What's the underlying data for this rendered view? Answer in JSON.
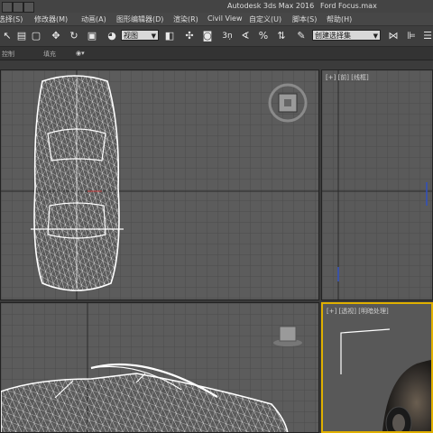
{
  "window": {
    "app_title": "Autodesk 3ds Max 2016",
    "file_title": "Ford Focus.max"
  },
  "menu": {
    "items": [
      {
        "id": "select",
        "label": "选择(S)"
      },
      {
        "id": "modifiers",
        "label": "修改器(M)"
      },
      {
        "id": "animation",
        "label": "动画(A)"
      },
      {
        "id": "graph-editors",
        "label": "图形编辑器(D)"
      },
      {
        "id": "rendering",
        "label": "渲染(R)"
      },
      {
        "id": "civil-view",
        "label": "Civil View"
      },
      {
        "id": "customize",
        "label": "自定义(U)"
      },
      {
        "id": "maxscript",
        "label": "脚本(S)"
      },
      {
        "id": "help",
        "label": "帮助(H)"
      }
    ]
  },
  "toolbar": {
    "reference_coord": "视图",
    "named_selection": "创建选择集",
    "snap_value": "3",
    "percent_snap": "%"
  },
  "ribbon": {
    "tab_label": "控制",
    "fill_label": "填充"
  },
  "viewports": {
    "top_label": "",
    "left_label": "[+] [前] [线框]",
    "front_label": "",
    "persp_label": "[+] [透视] [明暗处理]"
  },
  "colors": {
    "grid_line": "#4a4a4a",
    "grid_major": "#2e2e2e",
    "wireframe": "#ffffff",
    "active_border": "#e0b000",
    "axis_red": "#c03030"
  }
}
